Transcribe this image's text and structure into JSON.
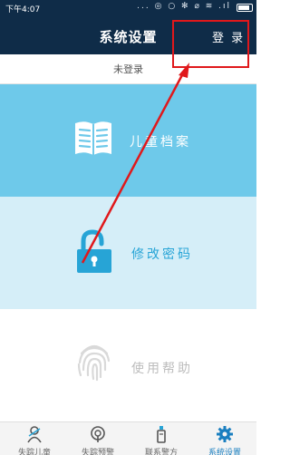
{
  "status_bar": {
    "time": "下午4:07",
    "icons": "... ◎ ○ ✻ ⌀ ≋ .ıl"
  },
  "header": {
    "title": "系统设置",
    "login_label": "登 录"
  },
  "user_status": "未登录",
  "menu": [
    {
      "label": "儿童档案",
      "icon": "book-icon"
    },
    {
      "label": "修改密码",
      "icon": "lock-icon"
    },
    {
      "label": "使用帮助",
      "icon": "fingerprint-icon"
    }
  ],
  "bottom_nav": [
    {
      "label": "失踪儿童",
      "icon": "child-icon"
    },
    {
      "label": "失踪预警",
      "icon": "alert-icon"
    },
    {
      "label": "联系警方",
      "icon": "police-icon"
    },
    {
      "label": "系统设置",
      "icon": "gear-icon",
      "active": true
    }
  ],
  "colors": {
    "header_bg": "#0f2c48",
    "card_children": "#6ec9ea",
    "card_password": "#d5eef8",
    "accent": "#27a4d6",
    "annotation": "#e0181b"
  }
}
